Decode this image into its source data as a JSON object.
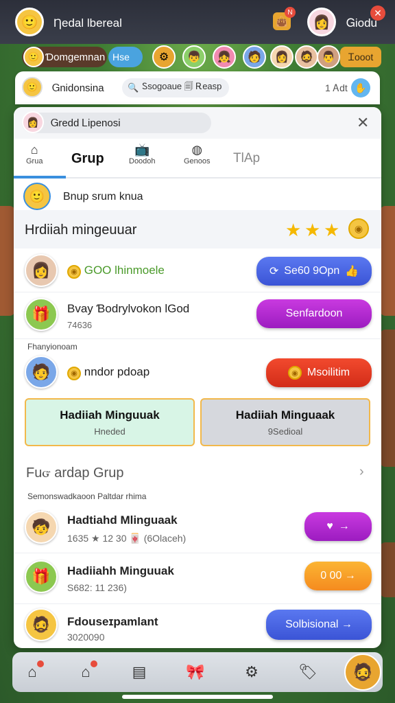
{
  "topbar": {
    "title": "Ƞedal lbereal",
    "bag_badge": "N",
    "right_label": "Ꮐiodu",
    "close_label": "✕"
  },
  "strip": {
    "user_name": "Ɗomgemnan",
    "hse_label": "Hse",
    "gold_label": "Ꮖooot"
  },
  "search": {
    "user_name": "Ꮐnidonsina",
    "search_text": "Ꮪsogoaue 🗐 Ꭱeasp",
    "count": "1 Ꭺdt",
    "search_icon": "search-icon",
    "action_icon": "hand-icon"
  },
  "panel": {
    "header_title": "Ꮐredd Ꮮipenosi",
    "tabs": [
      {
        "label": "Grua",
        "icon": "home-icon"
      },
      {
        "label": "Grup"
      },
      {
        "label": "Doodoh",
        "icon": "tv-icon"
      },
      {
        "label": "Genoos",
        "icon": "disc-icon"
      },
      {
        "label": "TlАp"
      }
    ],
    "group_row": "Bnup srum knua",
    "weekly_title": "Hrdiiah mingeuuar",
    "rows": [
      {
        "line1": "GOO lhinmoele",
        "line2": "",
        "button": "Se60 9Opn"
      },
      {
        "line1": "Bvay Ɓodrylvokon lGod",
        "line2": "74636",
        "button": "Senfardoon"
      },
      {
        "line1": "nndor pdoap",
        "line2": "",
        "button": "Msoilitim"
      }
    ],
    "section_small_1": "Fhanyionoam",
    "cards": [
      {
        "title": "Hadiiah Minguuak",
        "subtitle": "Hneded"
      },
      {
        "title": "Hadiiah Minguaak",
        "subtitle": "9Sedioal"
      }
    ],
    "join_group": "Fuᏻ ardap Grup",
    "section_small_2": "Semonswadkaoon Paltdar rhima",
    "list": [
      {
        "title": "Hadtiahd Mlinguaak",
        "sub": "1635 ★ 12 30 🀄 (6Olaceh)",
        "button": "→"
      },
      {
        "title": "Hadiiahh Minguuak",
        "sub": "S682: 11 236)",
        "button": "0 00 →"
      },
      {
        "title": "Fdouseɪpamlant",
        "sub": "3020090",
        "button": "Solbisional →"
      }
    ]
  },
  "colors": {
    "accent": "#3a8fde",
    "blue_btn": "#4862e0",
    "purple_btn": "#b52bd3",
    "red_btn": "#e83a22",
    "orange_btn": "#f8a02a",
    "green_card": "#d8f5e6",
    "gray_card": "#d6d8dd"
  }
}
